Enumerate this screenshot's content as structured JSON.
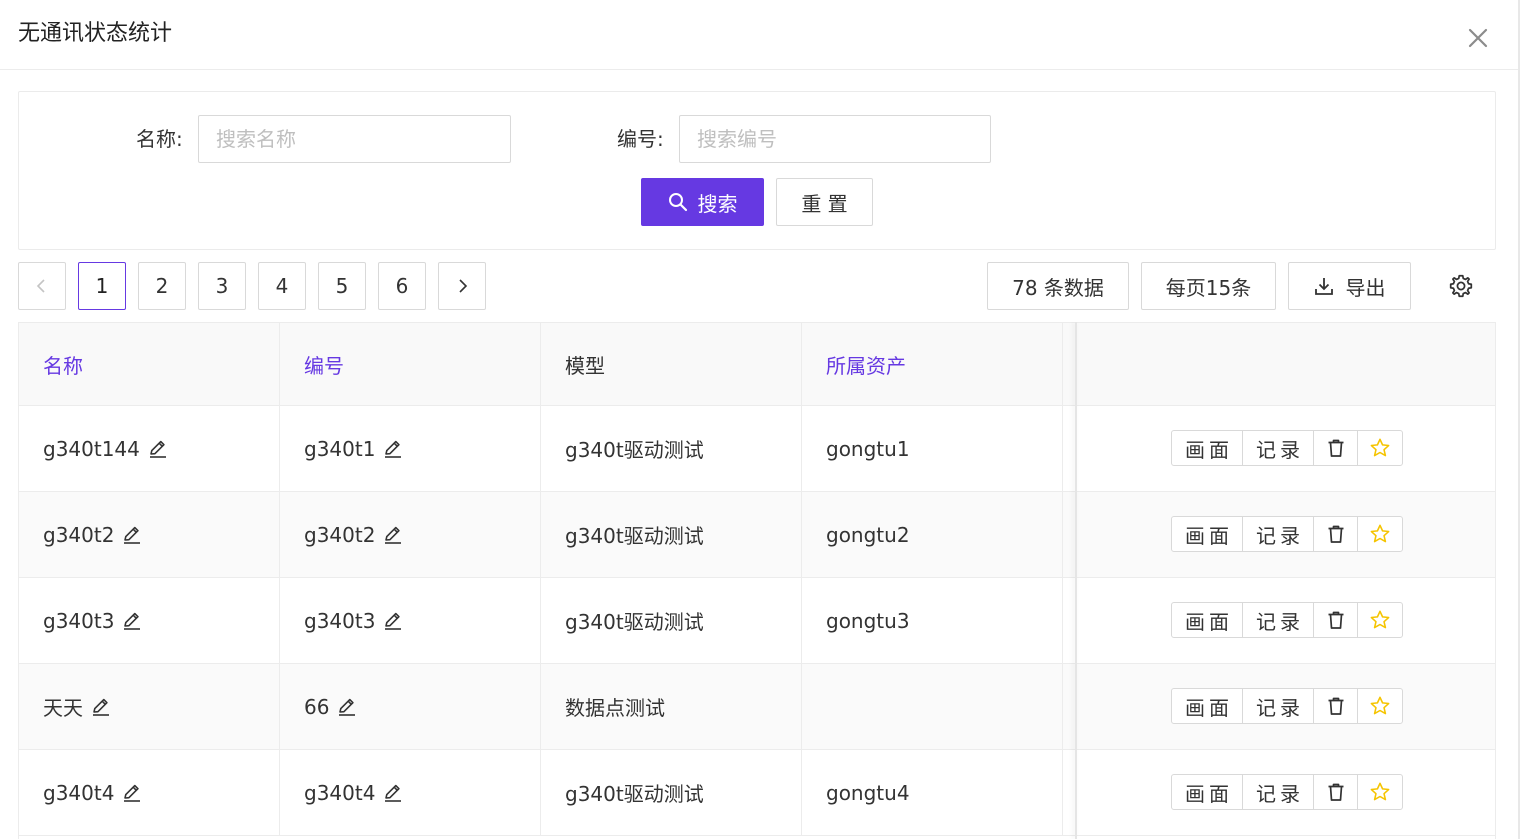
{
  "dialog": {
    "title": "无通讯状态统计"
  },
  "search": {
    "name_label": "名称:",
    "name_placeholder": "搜索名称",
    "name_value": "",
    "code_label": "编号:",
    "code_placeholder": "搜索编号",
    "code_value": "",
    "search_button": "搜索",
    "reset_button": "重 置"
  },
  "pagination": {
    "pages": [
      "1",
      "2",
      "3",
      "4",
      "5",
      "6"
    ],
    "current_page": "1",
    "prev_icon": "chevron-left-icon",
    "next_icon": "chevron-right-icon"
  },
  "toolbar": {
    "total": "78 条数据",
    "page_size": "每页15条",
    "export": "导出",
    "settings_icon": "gear-icon",
    "export_icon": "download-icon"
  },
  "table": {
    "columns": [
      "名称",
      "编号",
      "模型",
      "所属资产",
      ""
    ],
    "rows": [
      {
        "name": "g340t144",
        "code": "g340t1",
        "model": "g340t驱动测试",
        "asset": "gongtu1"
      },
      {
        "name": "g340t2",
        "code": "g340t2",
        "model": "g340t驱动测试",
        "asset": "gongtu2"
      },
      {
        "name": "g340t3",
        "code": "g340t3",
        "model": "g340t驱动测试",
        "asset": "gongtu3"
      },
      {
        "name": "天天",
        "code": "66",
        "model": "数据点测试",
        "asset": ""
      },
      {
        "name": "g340t4",
        "code": "g340t4",
        "model": "g340t驱动测试",
        "asset": "gongtu4"
      }
    ],
    "actions": {
      "screen": "画面",
      "record": "记录",
      "delete_icon": "trash-icon",
      "favorite_icon": "star-icon"
    }
  },
  "colors": {
    "primary": "#6639e2",
    "star": "#f5c400",
    "border": "#d9d9d9"
  }
}
